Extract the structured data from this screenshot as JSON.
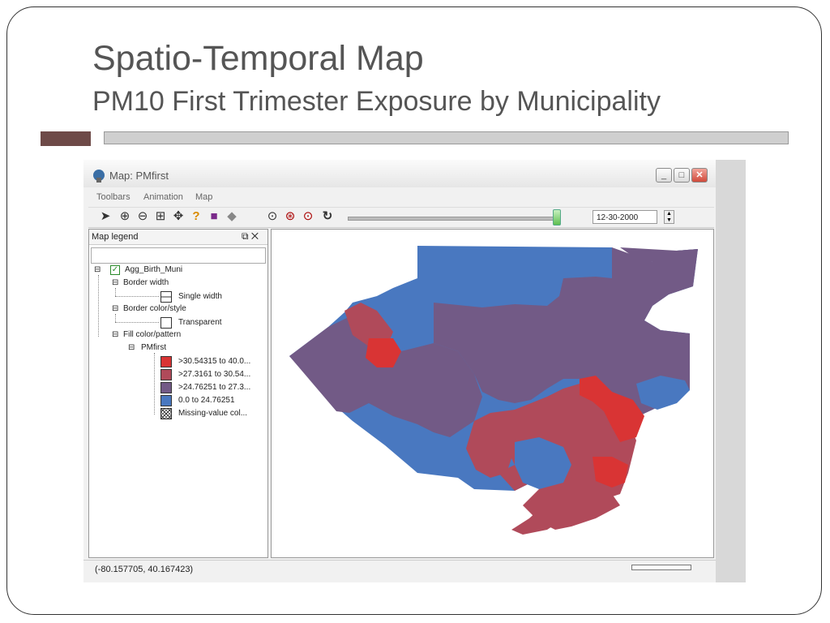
{
  "slide": {
    "title": "Spatio-Temporal Map",
    "subtitle": "PM10 First Trimester Exposure by Municipality"
  },
  "window": {
    "title": "Map: PMfirst",
    "menu": [
      "Toolbars",
      "Animation",
      "Map"
    ],
    "toolbar": {
      "date_value": "12-30-2000",
      "slider_level": 1.0
    },
    "legend": {
      "header": "Map legend",
      "layer": "Agg_Birth_Muni",
      "border_width": "Border width",
      "single_width": "Single width",
      "border_color": "Border color/style",
      "transparent": "Transparent",
      "fill_color": "Fill color/pattern",
      "variable": "PMfirst",
      "classes": [
        {
          "label": ">30.54315 to 40.0...",
          "color": "#d93434"
        },
        {
          "label": ">27.3161 to 30.54...",
          "color": "#b04a5a"
        },
        {
          "label": ">24.76251 to 27.3...",
          "color": "#725a86"
        },
        {
          "label": "0.0 to 24.76251",
          "color": "#4978c0"
        },
        {
          "label": "Missing-value col...",
          "color": "#ffffff"
        }
      ]
    },
    "status": {
      "coordinates": "(-80.157705, 40.167423)"
    }
  },
  "colors": {
    "accent_dark": "#6e4a48",
    "accent_bar": "#cfcfcf"
  }
}
